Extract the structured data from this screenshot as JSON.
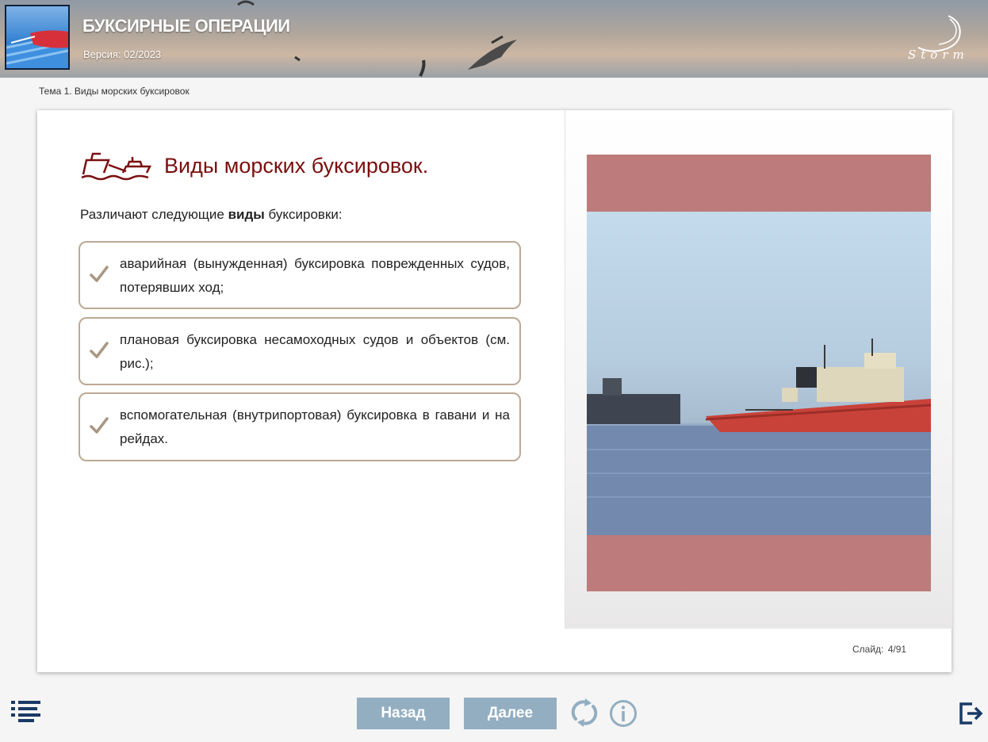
{
  "header": {
    "course_title": "БУКСИРНЫЕ ОПЕРАЦИИ",
    "version": "Версия: 02/2023",
    "brand": "Storm"
  },
  "breadcrumb": "Тема 1. Виды морских буксировок",
  "slide": {
    "title": "Виды морских буксировок.",
    "intro_before": "Различают следующие ",
    "intro_bold": "виды",
    "intro_after": " буксировки:",
    "items": [
      {
        "text": "аварийная (вынужденная) буксировка поврежденных судов, потерявших ход;"
      },
      {
        "text": "плановая буксировка несамоходных судов и объектов (см. рис.);"
      },
      {
        "text": "вспомогательная (внутрипортовая) буксировка в гавани и на рейдах."
      }
    ],
    "counter": "Слайд: 4/91"
  },
  "footer": {
    "back_label": "Назад",
    "next_label": "Далее"
  },
  "icons": {
    "menu": "list-menu-icon",
    "reload": "reload-icon",
    "info": "info-icon",
    "exit": "exit-icon",
    "check": "check-icon",
    "title": "tugboat-towing-icon"
  },
  "colors": {
    "title_red": "#7a0f0f",
    "item_border": "#bca994",
    "nav_button": "#93aec1",
    "photo_frame": "#bd7b7b",
    "icon_navy": "#1a3a66"
  }
}
